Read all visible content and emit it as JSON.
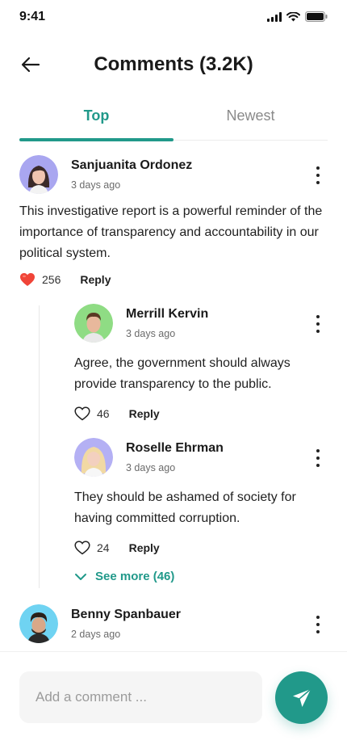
{
  "status_bar": {
    "time": "9:41"
  },
  "header": {
    "title": "Comments (3.2K)"
  },
  "tabs": [
    {
      "label": "Top",
      "active": true
    },
    {
      "label": "Newest",
      "active": false
    }
  ],
  "comments": [
    {
      "author": "Sanjuanita Ordonez",
      "time": "3 days ago",
      "text": "This investigative report is a powerful reminder of the importance of transparency and accountability in our political system.",
      "likes": "256",
      "liked": true,
      "reply_label": "Reply",
      "avatar_color": "#a9a6f0"
    },
    {
      "author": "Merrill Kervin",
      "time": "3 days ago",
      "text": "Agree, the government should always provide transparency to the public.",
      "likes": "46",
      "liked": false,
      "reply_label": "Reply",
      "avatar_color": "#8fdc84"
    },
    {
      "author": "Roselle Ehrman",
      "time": "3 days ago",
      "text": "They should be ashamed of society for having committed corruption.",
      "likes": "24",
      "liked": false,
      "reply_label": "Reply",
      "avatar_color": "#b4b0f4"
    },
    {
      "author": "Benny Spanbauer",
      "time": "2 days ago",
      "avatar_color": "#6fd3f2"
    }
  ],
  "see_more": "See more (46)",
  "comment_input": {
    "placeholder": "Add a comment ..."
  },
  "colors": {
    "accent": "#21998a",
    "like_red": "#f04438"
  }
}
